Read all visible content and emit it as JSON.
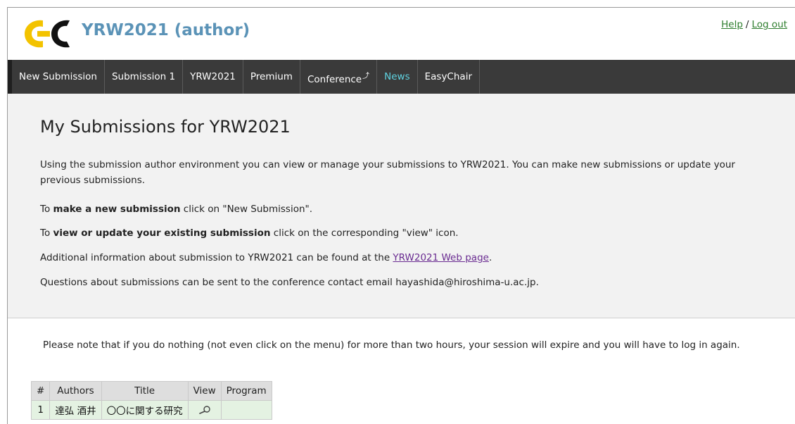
{
  "header": {
    "title": "YRW2021 (author)",
    "help_label": "Help",
    "separator": "/",
    "logout_label": "Log out"
  },
  "menu": {
    "items": [
      {
        "label": "New Submission"
      },
      {
        "label": "Submission 1"
      },
      {
        "label": "YRW2021"
      },
      {
        "label": "Premium"
      },
      {
        "label": "Conference"
      },
      {
        "label": "News"
      },
      {
        "label": "EasyChair"
      }
    ]
  },
  "main": {
    "title": "My Submissions for YRW2021",
    "intro": "Using the submission author environment you can view or manage your submissions to YRW2021. You can make new submissions or update your previous submissions.",
    "new_prefix": "To ",
    "new_bold": "make a new submission",
    "new_suffix": " click on \"New Submission\".",
    "update_prefix": "To ",
    "update_bold": "view or update your existing submission",
    "update_suffix": " click on the corresponding \"view\" icon.",
    "info_prefix": "Additional information about submission to YRW2021 can be found at the ",
    "info_link": "YRW2021 Web page",
    "info_suffix": ".",
    "contact": "Questions about submissions can be sent to the conference contact email hayashida@hiroshima-u.ac.jp."
  },
  "note": "Please note that if you do nothing (not even click on the menu) for more than two hours, your session will expire and you will have to log in again.",
  "table": {
    "headers": [
      "#",
      "Authors",
      "Title",
      "View",
      "Program"
    ],
    "rows": [
      {
        "num": "1",
        "authors": "達弘 酒井",
        "title": "〇〇に関する研究",
        "program": ""
      }
    ]
  },
  "colors": {
    "title": "#5b93b7",
    "menu_bg": "#3a3a3a",
    "news": "#5fd2e0",
    "link_green": "#2d7d2d",
    "row_green": "#e4f2e2"
  },
  "icons": {
    "logo": "easychair-logo",
    "view": "magnifier-icon",
    "external": "external-link-icon"
  }
}
